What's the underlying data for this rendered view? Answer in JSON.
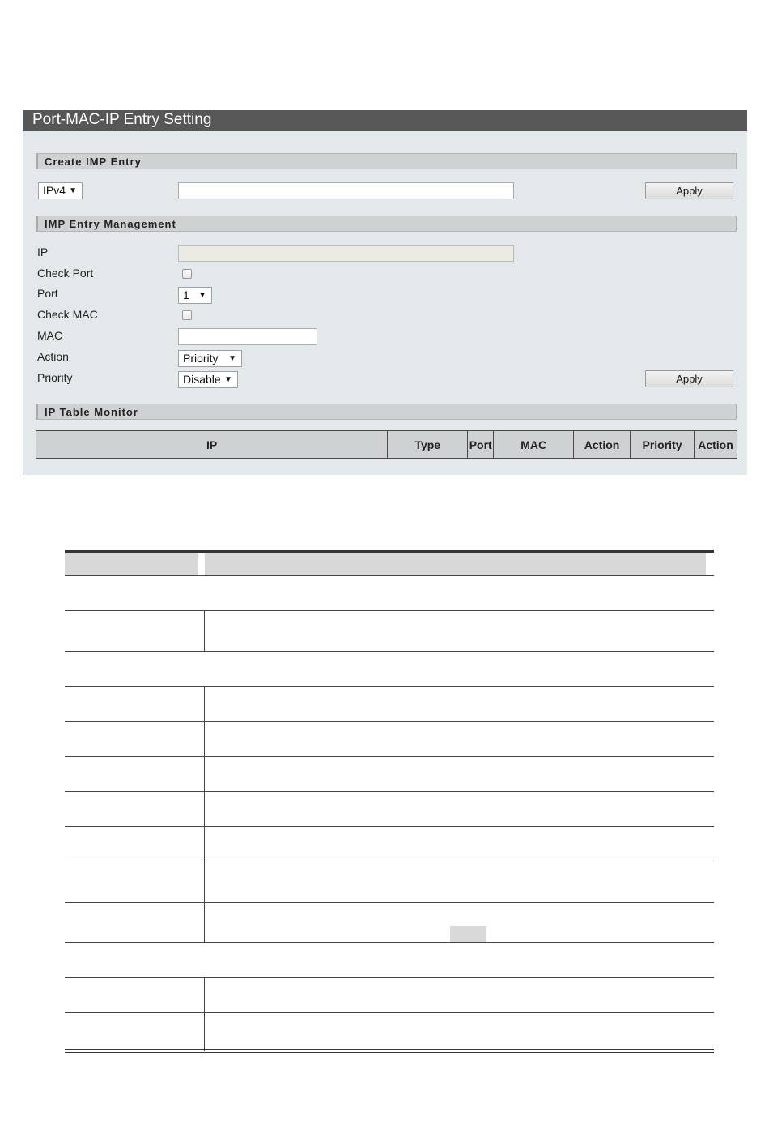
{
  "panel": {
    "title": "Port-MAC-IP Entry Setting"
  },
  "create_section": {
    "header": "Create IMP Entry",
    "ip_type_select": "IPv4",
    "address_value": "",
    "apply_label": "Apply"
  },
  "management_section": {
    "header": "IMP Entry Management",
    "ip_label": "IP",
    "check_port_label": "Check Port",
    "check_port_checked": false,
    "port_label": "Port",
    "port_value": "1",
    "check_mac_label": "Check MAC",
    "check_mac_checked": false,
    "mac_label": "MAC",
    "mac_value": "",
    "action_label": "Action",
    "action_value": "Priority",
    "priority_label": "Priority",
    "priority_value": "Disable",
    "apply_label": "Apply"
  },
  "monitor_section": {
    "header": "IP Table Monitor",
    "columns": [
      "IP",
      "Type",
      "Port",
      "MAC",
      "Action",
      "Priority",
      "Action"
    ]
  },
  "icons": {
    "dropdown": "dropdown-arrow-icon"
  },
  "colors": {
    "title_bar": "#575757",
    "panel_bg": "#e3e8ea",
    "section_header_bg": "#cfd2d3"
  }
}
